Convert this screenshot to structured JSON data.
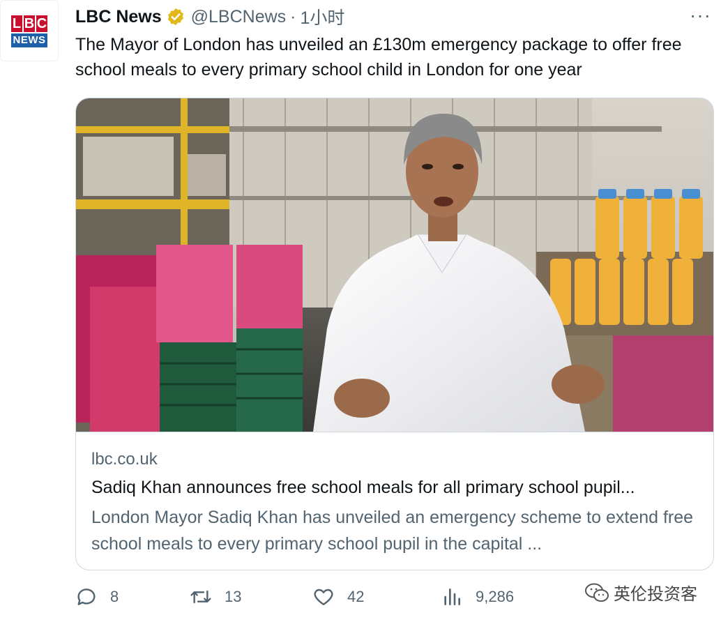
{
  "avatar": {
    "logo_top": "LBC",
    "logo_bottom": "NEWS",
    "brand_red": "#c8102e",
    "brand_blue": "#1d5fa8"
  },
  "header": {
    "name": "LBC News",
    "handle": "@LBCNews",
    "separator": "·",
    "time": "1小时",
    "more": "···"
  },
  "tweet": {
    "text": "The Mayor of London has unveiled an £130m emergency package to offer free school meals to every primary school child in London for one year"
  },
  "card": {
    "image_icon": "photo",
    "domain": "lbc.co.uk",
    "title": "Sadiq Khan announces free school meals for all primary school pupil...",
    "description": "London Mayor Sadiq Khan has unveiled an emergency scheme to extend free school meals to every primary school pupil in the capital ..."
  },
  "actions": {
    "replies": "8",
    "retweets": "13",
    "likes": "42",
    "views": "9,286"
  },
  "watermark": {
    "text": "英伦投资客"
  },
  "colors": {
    "text": "#0f1419",
    "muted": "#536471",
    "border": "#cfd9de",
    "verified_gold": "#e2b719"
  }
}
